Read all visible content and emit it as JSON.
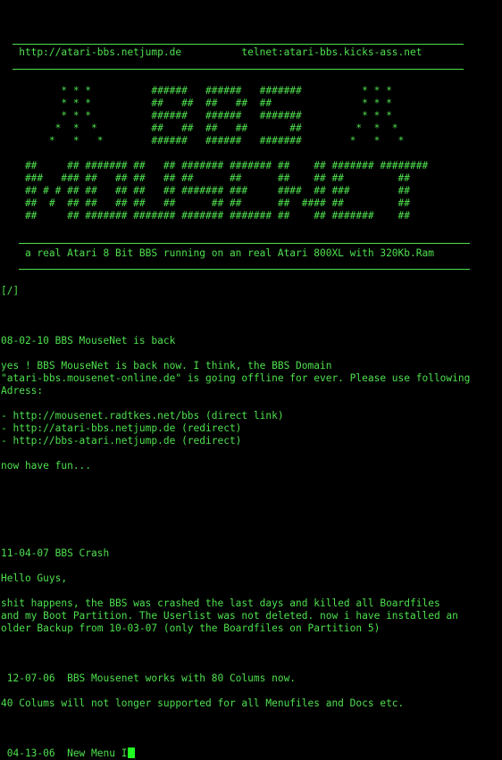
{
  "colors": {
    "background": "#000000",
    "text": "#4ee04e",
    "cursor": "#22ff22"
  },
  "header": {
    "url_line": "   http://atari-bbs.netjump.de          telnet:atari-bbs.kicks-ass.net",
    "logo": [
      "          * * *          ######   ######   #######          * * *",
      "          * * *          ##   ##  ##   ##  ##               * * *",
      "          * * *          ######   ######   #######          * * *",
      "         *  *  *         ##   ##  ##   ##       ##         *  *  *",
      "        *   *   *        ######   ######   #######        *   *   *",
      "",
      "    ##     ## ####### ##   ## ####### ####### ##    ## ####### ########",
      "    ###   ### ##   ## ##   ## ##      ##      ##    ## ##         ##",
      "    ## # # ## ##   ## ##   ## ####### ###     ####  ## ###        ##",
      "    ##  #  ## ##   ## ##   ##      ## ##      ##  #### ##         ##",
      "    ##     ## ####### ####### ####### ####### ##    ## #######    ##"
    ],
    "tagline": "    a real Atari 8 Bit BBS running on an real Atari 800XL with 320Kb.Ram"
  },
  "root_link": "[/]",
  "posts": {
    "p1_title": "08-02-10 BBS MouseNet is back",
    "p1_body_1": "yes ! BBS MouseNet is back now. I think, the BBS Domain",
    "p1_body_2": "\"atari-bbs.mousenet-online.de\" is going offline for ever. Please use following",
    "p1_body_3": "Adress:",
    "p1_link_1": "- http://mousenet.radtkes.net/bbs (direct link)",
    "p1_link_2": "- http://atari-bbs.netjump.de (redirect)",
    "p1_link_3": "- http://bbs-atari.netjump.de (redirect)",
    "p1_outro": "now have fun...",
    "p2_title": "11-04-07 BBS Crash",
    "p2_greeting": "Hello Guys,",
    "p2_body_1": "shit happens, the BBS was crashed the last days and killed all Boardfiles",
    "p2_body_2": "and my Boot Partition. The Userlist was not deleted. now i have installed an",
    "p2_body_3": "older Backup from 10-03-07 (only the Boardfiles on Partition 5)",
    "p3_title": " 12-07-06  BBS Mousenet works with 80 Colums now.",
    "p3_body": "40 Colums will not longer supported for all Menufiles and Docs etc.",
    "p4_title": " 04-13-06  New Menu I"
  }
}
